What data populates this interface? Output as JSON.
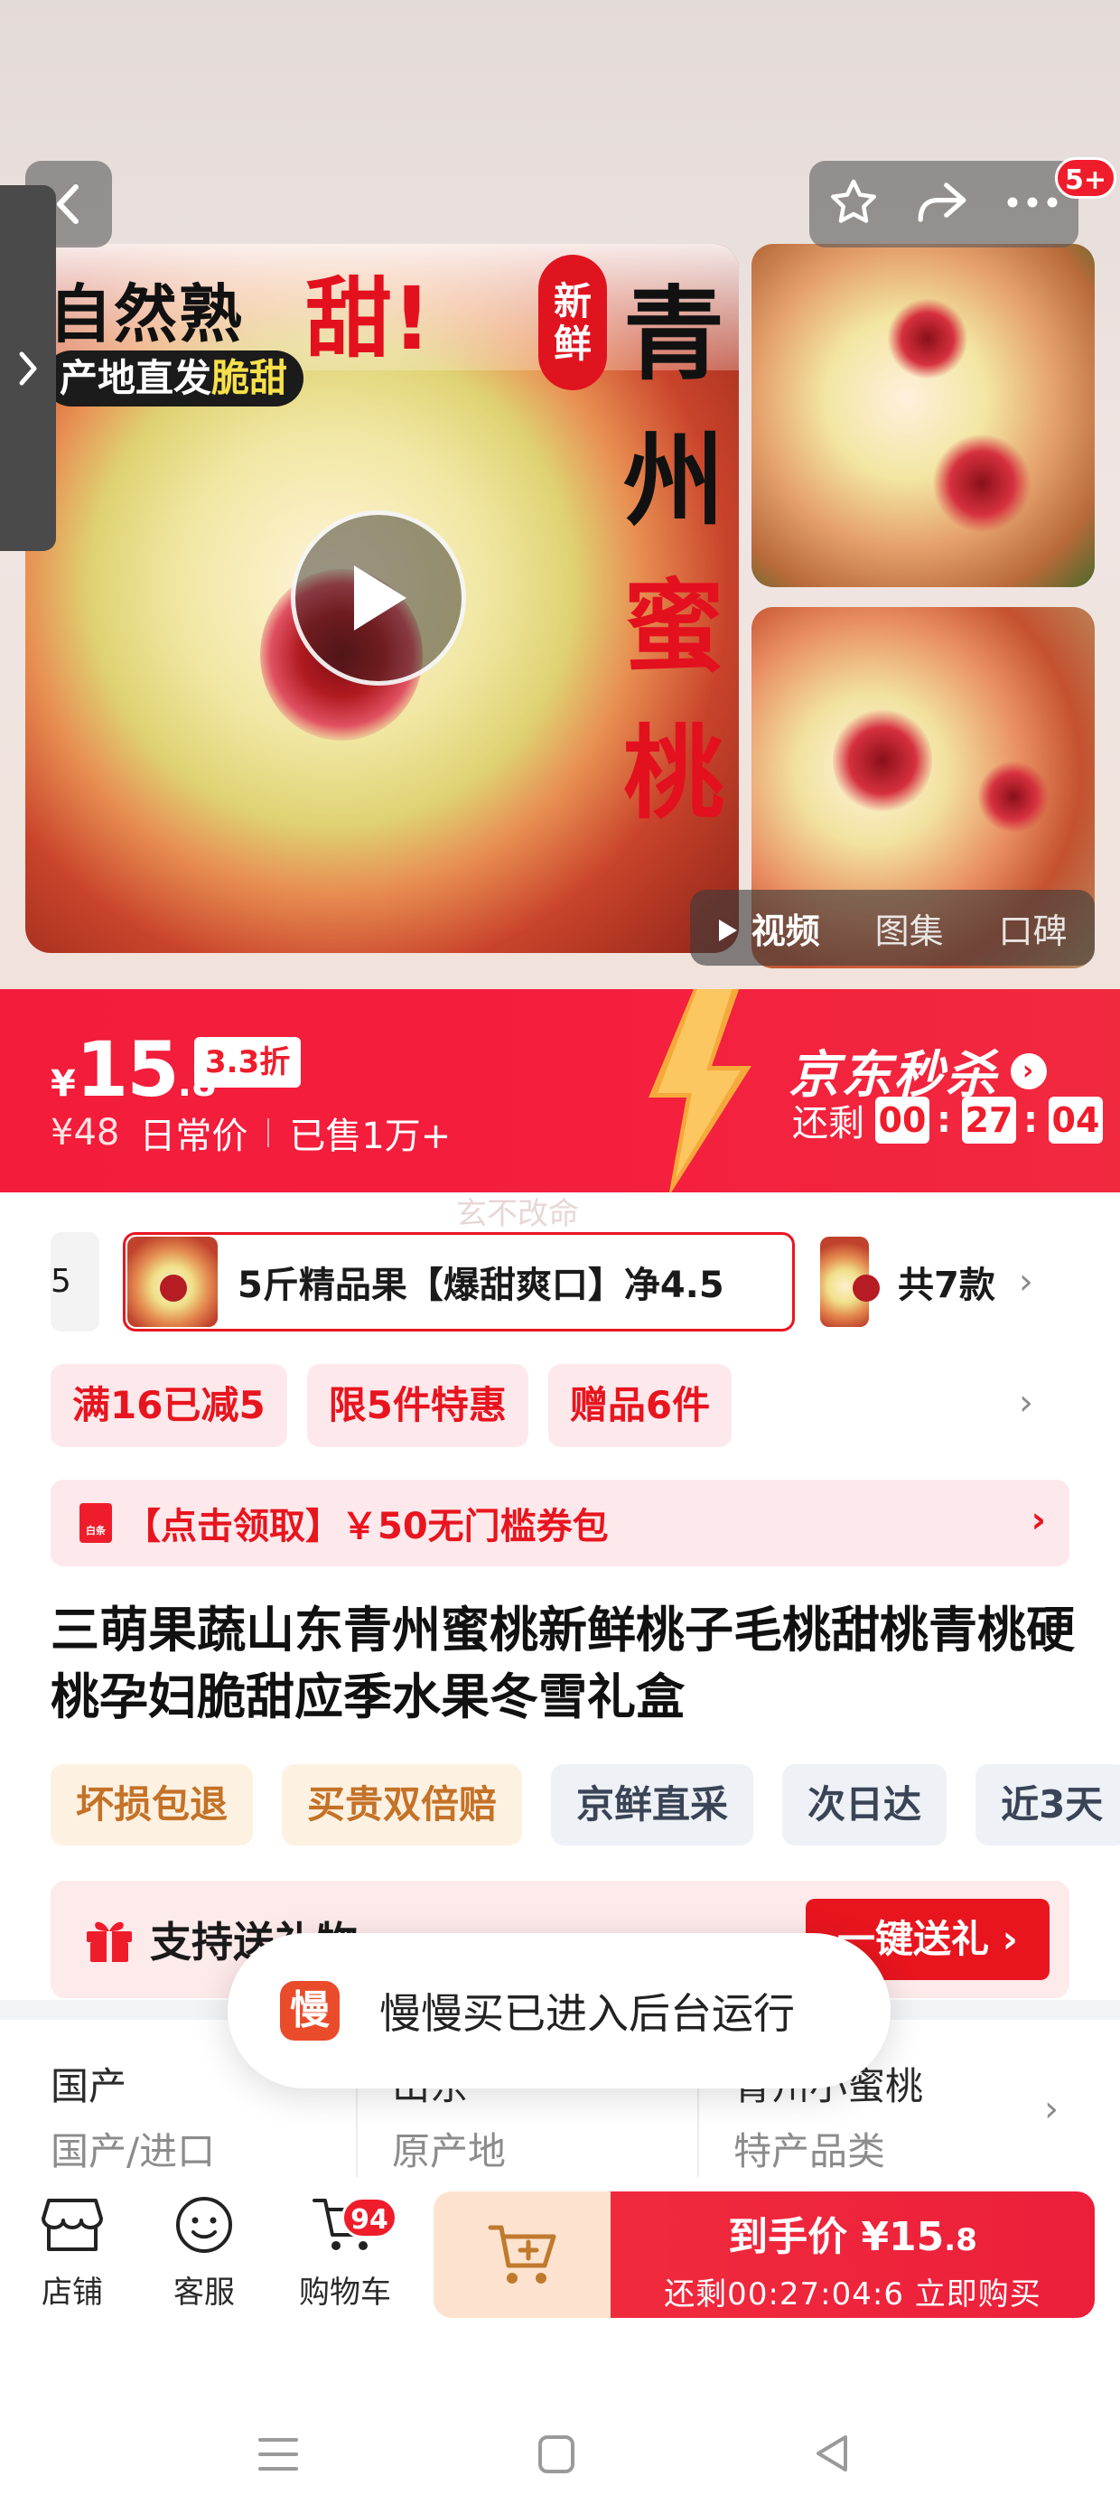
{
  "gallery": {
    "main_image": {
      "headline_left": "自然熟",
      "headline_red": "甜!",
      "ribbon_prefix": "产地直发",
      "ribbon_highlight": "脆甜",
      "seal_top": "新",
      "seal_bottom": "鲜",
      "vertical_title": [
        "青",
        "州",
        "蜜",
        "桃"
      ]
    },
    "media_tabs": [
      "视频",
      "图集",
      "口碑"
    ],
    "share_badge": "5+"
  },
  "flash_sale": {
    "currency": "¥",
    "price_int": "15",
    "price_dec": ".8",
    "discount_badge": "3.3折",
    "original_price": "¥48",
    "original_label": "日常价",
    "sold": "已售1万+",
    "brand": "京东秒杀",
    "remaining_label": "还剩",
    "countdown": {
      "h": "00",
      "m": "27",
      "s": "04"
    }
  },
  "watermark": "玄不改命",
  "sku": {
    "prev_label": "5",
    "active_label": "5斤精品果【爆甜爽口】净4.5",
    "more_label": "共7款"
  },
  "promos": [
    "满16已减5",
    "限5件特惠",
    "赠品6件"
  ],
  "coupon": {
    "icon_text": "白条",
    "label": "【点击领取】￥50无门槛券包"
  },
  "product_title": "三萌果蔬山东青州蜜桃新鲜桃子毛桃甜桃青桃硬桃孕妇脆甜应季水果冬雪礼盒",
  "services": [
    {
      "label": "坏损包退",
      "tone": "warm"
    },
    {
      "label": "买贵双倍赔",
      "tone": "warm"
    },
    {
      "label": "京鲜直采",
      "tone": "cool"
    },
    {
      "label": "次日达",
      "tone": "cool"
    },
    {
      "label": "近3天",
      "tone": "cool"
    }
  ],
  "gift": {
    "label": "支持送礼物",
    "button": "一键送礼"
  },
  "specs": [
    {
      "value": "国产",
      "key": "国产/进口"
    },
    {
      "value": "山东",
      "key": "原产地"
    },
    {
      "value": "青州小蜜桃",
      "key": "特产品类"
    }
  ],
  "toast": {
    "icon_text": "慢",
    "message": "慢慢买已进入后台运行"
  },
  "bottom_bar": {
    "shop": "店铺",
    "service": "客服",
    "cart": "购物车",
    "cart_count": "94",
    "buy_price_label": "到手价",
    "buy_price": "¥15",
    "buy_price_dec": ".8",
    "buy_sub": "还剩00:27:04:6  立即购买"
  },
  "colors": {
    "brand_red": "#ef1d2b",
    "promo_bg": "#fde9ec",
    "warm_tag_text": "#c47227",
    "cool_tag_text": "#3a4456"
  }
}
